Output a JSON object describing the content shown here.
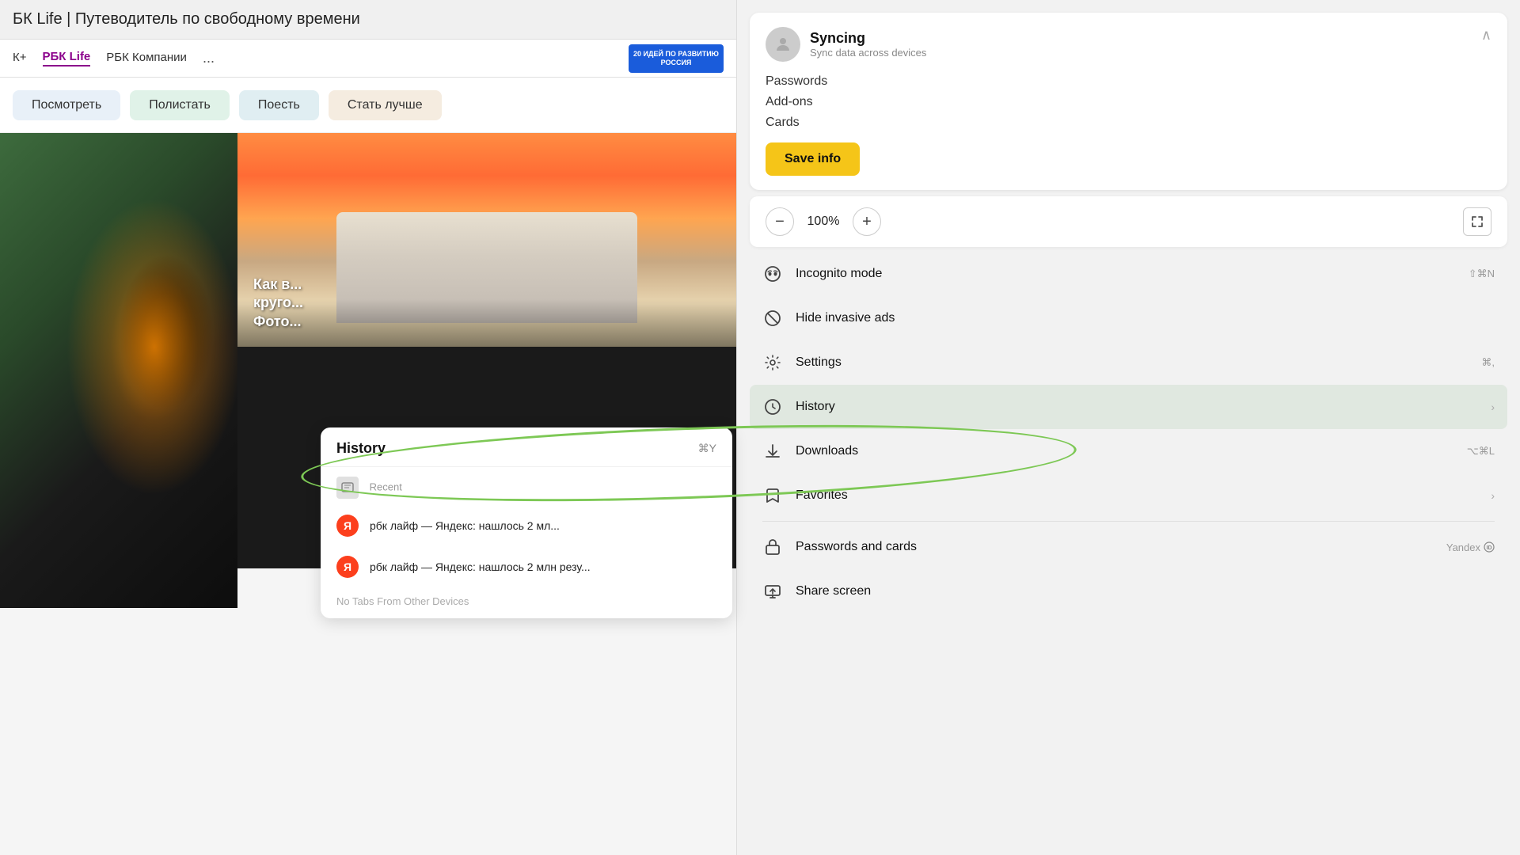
{
  "browser": {
    "page_title": "БК Life | Путеводитель по свободному времени",
    "nav_items": [
      {
        "label": "К+",
        "active": false
      },
      {
        "label": "РБК Life",
        "active": true
      },
      {
        "label": "РБК Компании",
        "active": false
      }
    ],
    "nav_more": "...",
    "logo_text": "20 ИДЕЙ ПО РАЗВИТИЮ РОССИЯ"
  },
  "categories": [
    {
      "label": "Посмотреть",
      "style": "blue"
    },
    {
      "label": "Полистать",
      "style": "green"
    },
    {
      "label": "Поесть",
      "style": "teal"
    },
    {
      "label": "Стать лучше",
      "style": "orange"
    }
  ],
  "ship_caption": "Как в...\nкруго...\nФото...",
  "history_dropdown": {
    "title": "History",
    "shortcut": "⌘Y",
    "sections": [
      {
        "label": "Recent",
        "type": "header"
      }
    ],
    "items": [
      {
        "text": "рбк лайф — Яндекс: нашлось 2 мл...",
        "icon": "yandex"
      },
      {
        "text": "рбк лайф — Яндекс: нашлось 2 млн резу...",
        "icon": "yandex"
      }
    ],
    "footer": "No Tabs From Other Devices"
  },
  "menu": {
    "sync": {
      "title": "Syncing",
      "subtitle": "Sync data across devices",
      "items": [
        {
          "label": "Passwords"
        },
        {
          "label": "Add-ons"
        },
        {
          "label": "Cards"
        }
      ],
      "save_button": "Save info"
    },
    "zoom": {
      "decrease": "−",
      "value": "100%",
      "increase": "+",
      "expand_icon": "⤢"
    },
    "items": [
      {
        "label": "Incognito mode",
        "shortcut": "⇧⌘N",
        "icon": "🎭",
        "has_arrow": false
      },
      {
        "label": "Hide invasive ads",
        "shortcut": "",
        "icon": "🚫",
        "has_arrow": false
      },
      {
        "label": "Settings",
        "shortcut": "⌘,",
        "icon": "⚙️",
        "has_arrow": false
      },
      {
        "label": "History",
        "shortcut": "",
        "icon": "🕐",
        "has_arrow": true,
        "highlighted": true
      },
      {
        "label": "Downloads",
        "shortcut": "⌥⌘L",
        "icon": "⬇️",
        "has_arrow": false
      },
      {
        "label": "Favorites",
        "shortcut": "",
        "icon": "🔖",
        "has_arrow": true
      },
      {
        "label": "Passwords and cards",
        "shortcut": "",
        "icon": "🏦",
        "has_arrow": false,
        "badge": "Yandex ID"
      },
      {
        "label": "Share screen",
        "shortcut": "",
        "icon": "📺",
        "has_arrow": false
      }
    ]
  }
}
